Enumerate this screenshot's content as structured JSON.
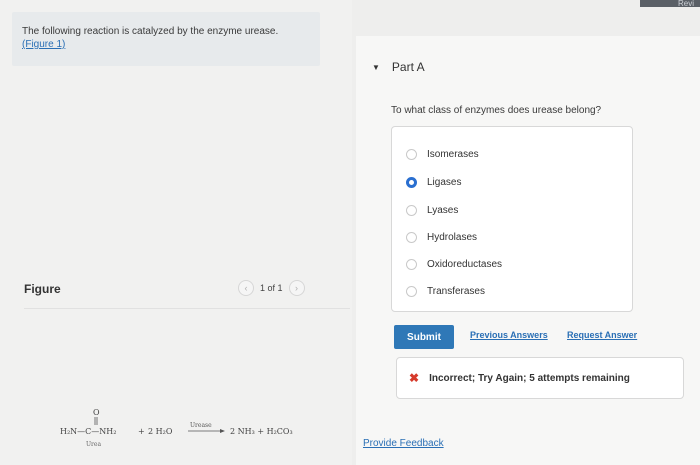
{
  "topbar": {
    "label": "Revi"
  },
  "intro": {
    "text": "The following reaction is catalyzed by the enzyme urease.",
    "link": "(Figure 1)"
  },
  "figure": {
    "title": "Figure",
    "pager_text": "1 of 1",
    "prev_icon": "chevron-left-icon",
    "next_icon": "chevron-right-icon"
  },
  "equation": {
    "reactant1": "H₂N—C—NH₂",
    "carbonyl_o": "O",
    "plus1": "+",
    "reactant2": "2 H₂O",
    "enzyme": "Urease",
    "products": "2 NH₃ + H₂CO₃",
    "reactant1_name": "Urea"
  },
  "part": {
    "label": "Part A",
    "icon": "caret-down-icon"
  },
  "question": "To what class of enzymes does urease belong?",
  "options": [
    {
      "label": "Isomerases",
      "selected": false
    },
    {
      "label": "Ligases",
      "selected": true
    },
    {
      "label": "Lyases",
      "selected": false
    },
    {
      "label": "Hydrolases",
      "selected": false
    },
    {
      "label": "Oxidoreductases",
      "selected": false
    },
    {
      "label": "Transferases",
      "selected": false
    }
  ],
  "actions": {
    "submit": "Submit",
    "previous_answers": "Previous Answers",
    "request_answer": "Request Answer"
  },
  "feedback": {
    "icon": "x-icon",
    "text": "Incorrect; Try Again; 5 attempts remaining"
  },
  "provide_feedback": "Provide Feedback",
  "colors": {
    "accent": "#2f78b7",
    "selected_radio": "#2a6fd0",
    "error": "#d63a2b",
    "link": "#2a6fb5"
  }
}
